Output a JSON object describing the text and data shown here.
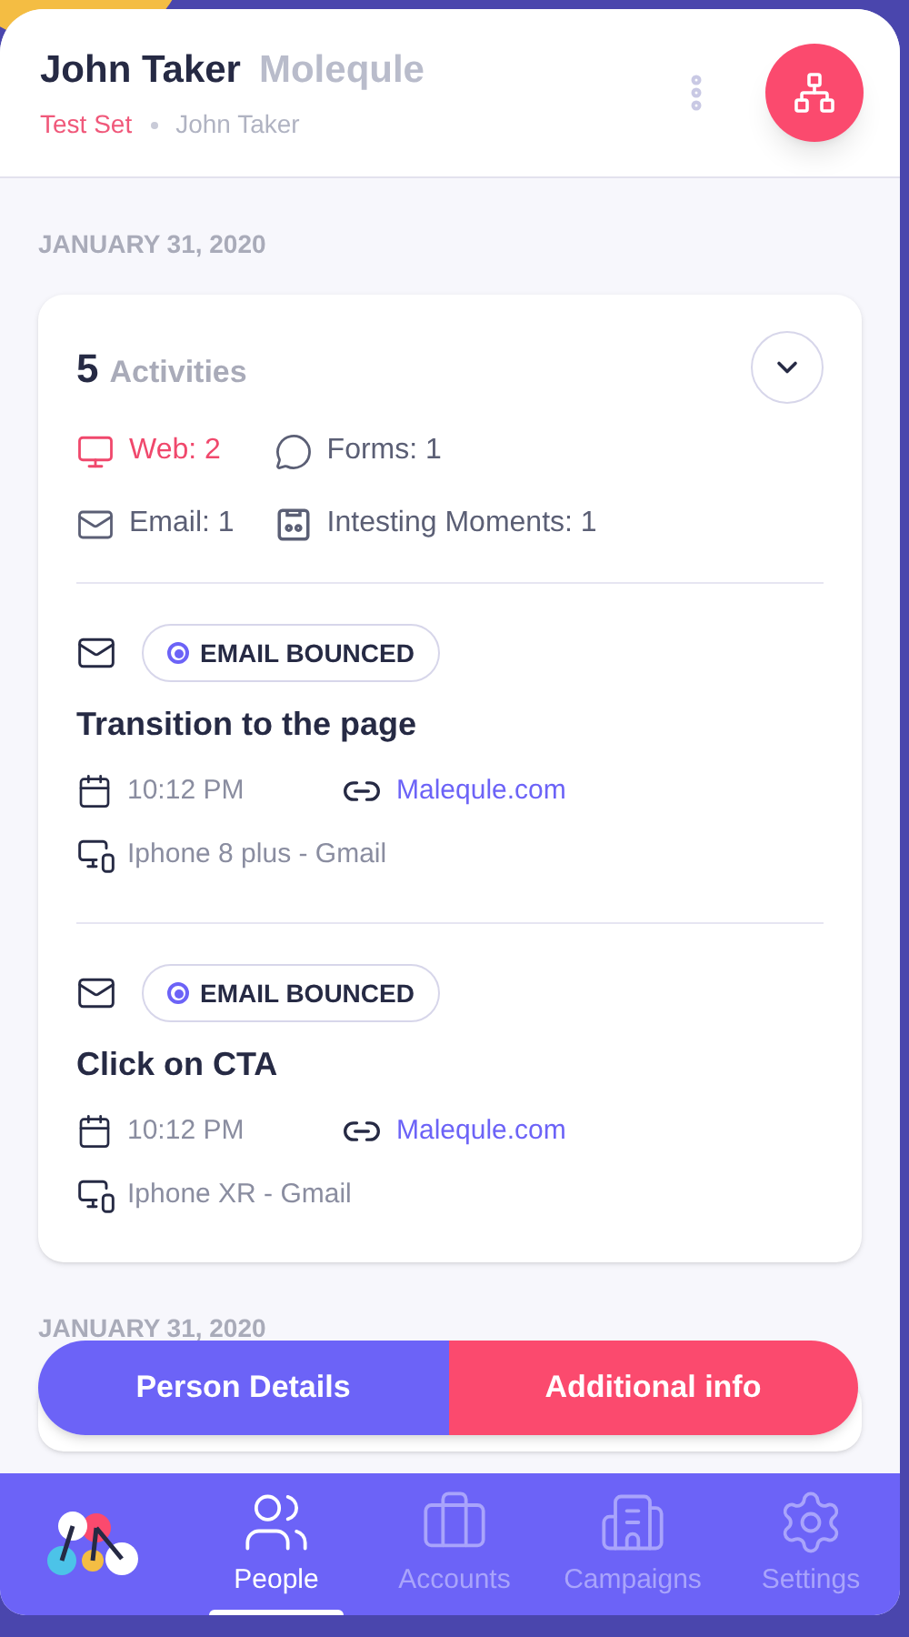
{
  "header": {
    "name": "John Taker",
    "company": "Molequle",
    "set": "Test Set",
    "owner": "John Taker"
  },
  "sections": [
    {
      "date": "JANUARY 31, 2020",
      "count": "5",
      "count_label": "Activities",
      "stats": [
        {
          "kind": "web",
          "label": "Web: 2",
          "selected": true
        },
        {
          "kind": "forms",
          "label": "Forms: 1",
          "selected": false
        },
        {
          "kind": "email",
          "label": "Email: 1",
          "selected": false
        },
        {
          "kind": "moments",
          "label": "Intesting Moments: 1",
          "selected": false
        }
      ],
      "activities": [
        {
          "status": "EMAIL BOUNCED",
          "title": "Transition to the page",
          "time": "10:12 PM",
          "link": "Malequle.com",
          "device": "Iphone 8 plus - Gmail"
        },
        {
          "status": "EMAIL BOUNCED",
          "title": "Click on CTA",
          "time": "10:12 PM",
          "link": "Malequle.com",
          "device": "Iphone XR - Gmail"
        }
      ]
    },
    {
      "date": "JANUARY 31, 2020"
    }
  ],
  "actions": [
    {
      "kind": "primary",
      "label": "Person Details"
    },
    {
      "kind": "accent",
      "label": "Additional info"
    }
  ],
  "nav": [
    {
      "kind": "people",
      "label": "People",
      "selected": true
    },
    {
      "kind": "accounts",
      "label": "Accounts",
      "selected": false
    },
    {
      "kind": "campaigns",
      "label": "Campaigns",
      "selected": false
    },
    {
      "kind": "settings",
      "label": "Settings",
      "selected": false
    }
  ]
}
